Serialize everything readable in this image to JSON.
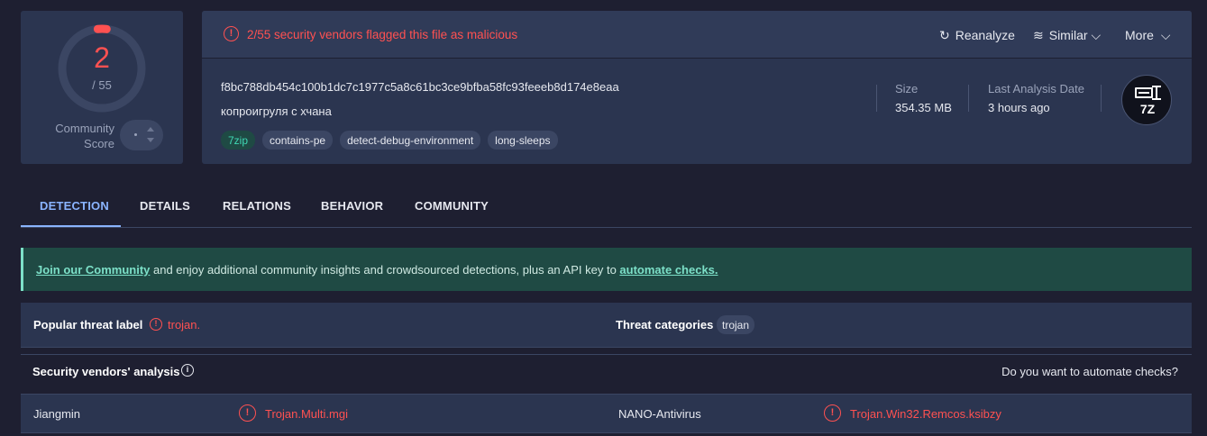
{
  "score": {
    "value": "2",
    "total": "/ 55",
    "community_label_1": "Community",
    "community_label_2": "Score",
    "flagged_fraction": 0.036
  },
  "header": {
    "alert": "2/55 security vendors flagged this file as malicious",
    "reanalyze": "Reanalyze",
    "similar": "Similar",
    "more": "More"
  },
  "file": {
    "hash": "f8bc788db454c100b1dc7c1977c5a8c61bc3ce9bfba58fc93feeeb8d174e8eaa",
    "name": "копроигруля с хчана",
    "tags": [
      "7zip",
      "contains-pe",
      "detect-debug-environment",
      "long-sleeps"
    ],
    "size_label": "Size",
    "size_value": "354.35 MB",
    "date_label": "Last Analysis Date",
    "date_value": "3 hours ago",
    "type_icon": "7Z"
  },
  "tabs": [
    "DETECTION",
    "DETAILS",
    "RELATIONS",
    "BEHAVIOR",
    "COMMUNITY"
  ],
  "banner": {
    "link1": "Join our Community",
    "middle": " and enjoy additional community insights and crowdsourced detections, plus an API key to ",
    "link2": "automate checks."
  },
  "threat": {
    "popular_label": "Popular threat label",
    "popular_value": "trojan.",
    "categories_label": "Threat categories",
    "category": "trojan"
  },
  "vendors": {
    "title": "Security vendors' analysis",
    "automate": "Do you want to automate checks?",
    "rows": [
      {
        "left_name": "Jiangmin",
        "left_result": "Trojan.Multi.mgi",
        "right_name": "NANO-Antivirus",
        "right_result": "Trojan.Win32.Remcos.ksibzy"
      }
    ]
  },
  "colors": {
    "malicious": "#ff5151",
    "accent": "#8ab4ff",
    "teal": "#7ce0c8"
  }
}
